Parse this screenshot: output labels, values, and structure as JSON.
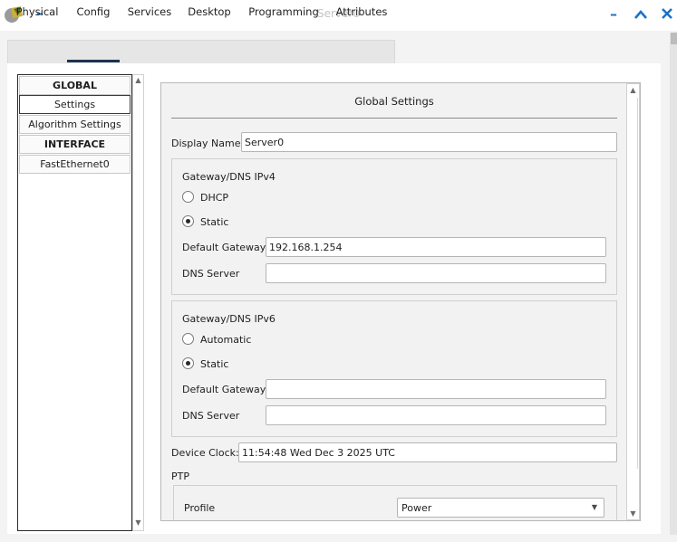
{
  "window": {
    "title": "Server0"
  },
  "tabs": [
    "Physical",
    "Config",
    "Services",
    "Desktop",
    "Programming",
    "Attributes"
  ],
  "sidebar": {
    "items": [
      {
        "label": "GLOBAL",
        "header": true
      },
      {
        "label": "Settings",
        "selected": true
      },
      {
        "label": "Algorithm Settings"
      },
      {
        "label": "INTERFACE",
        "header": true
      },
      {
        "label": "FastEthernet0"
      }
    ]
  },
  "global_settings": {
    "heading": "Global Settings",
    "display_name": {
      "label": "Display Name",
      "value": "Server0"
    },
    "ipv4": {
      "title": "Gateway/DNS IPv4",
      "dhcp_label": "DHCP",
      "static_label": "Static",
      "selected": "Static",
      "gateway_label": "Default Gateway",
      "gateway_value": "192.168.1.254",
      "dns_label": "DNS Server",
      "dns_value": ""
    },
    "ipv6": {
      "title": "Gateway/DNS IPv6",
      "automatic_label": "Automatic",
      "static_label": "Static",
      "selected": "Static",
      "gateway_label": "Default Gateway",
      "gateway_value": "",
      "dns_label": "DNS Server",
      "dns_value": ""
    },
    "device_clock": {
      "label": "Device Clock:",
      "value": "11:54:48 Wed Dec 3 2025 UTC"
    },
    "ptp": {
      "title": "PTP",
      "profile_label": "Profile",
      "profile_value": "Power"
    }
  },
  "colors": {
    "accent": "#1a73c8",
    "tab_underline": "#1e3250"
  }
}
